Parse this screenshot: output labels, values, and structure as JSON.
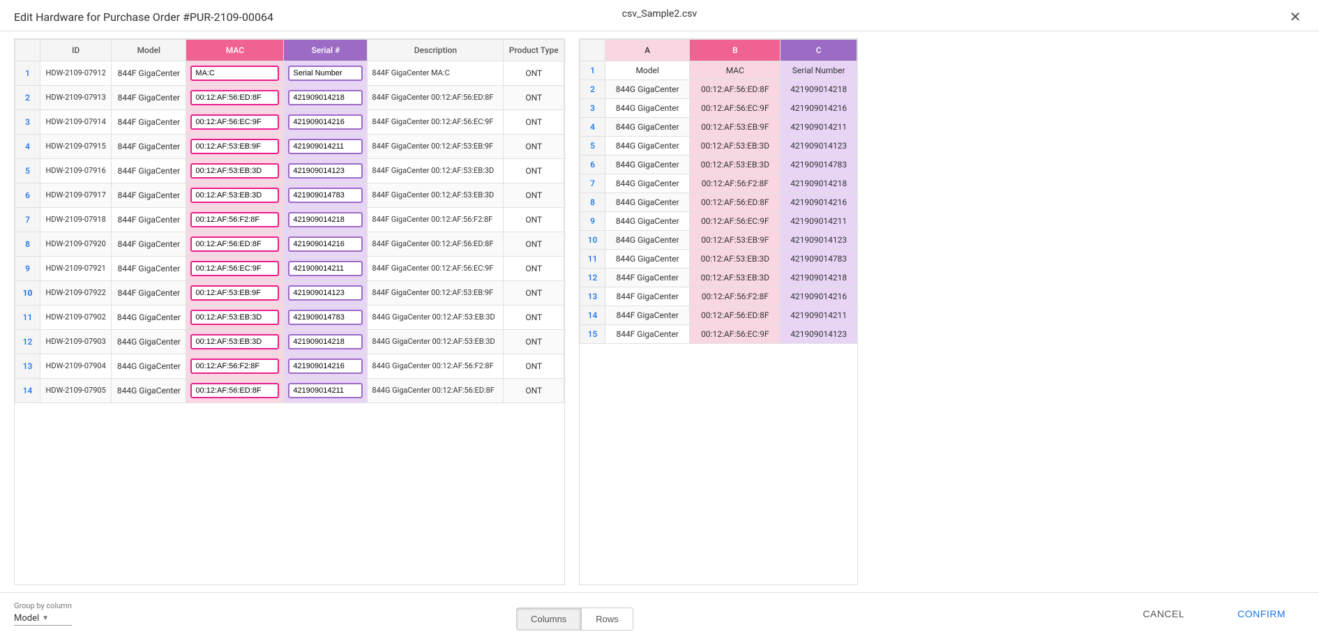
{
  "header": {
    "title": "Edit Hardware for Purchase Order #PUR-2109-00064",
    "csv_filename": "csv_Sample2.csv",
    "close_label": "×"
  },
  "left_table": {
    "columns": [
      "",
      "ID",
      "Model",
      "MAC",
      "Serial #",
      "Description",
      "Product Type"
    ],
    "rows": [
      {
        "num": 1,
        "id": "HDW-2109-07912",
        "model": "844F GigaCenter",
        "mac": "MA:C",
        "serial": "Serial Number",
        "desc": "844F GigaCenter MA:C",
        "type": "ONT"
      },
      {
        "num": 2,
        "id": "HDW-2109-07913",
        "model": "844F GigaCenter",
        "mac": "00:12:AF:56:ED:8F",
        "serial": "421909014218",
        "desc": "844F GigaCenter 00:12:AF:56:ED:8F",
        "type": "ONT"
      },
      {
        "num": 3,
        "id": "HDW-2109-07914",
        "model": "844F GigaCenter",
        "mac": "00:12:AF:56:EC:9F",
        "serial": "421909014216",
        "desc": "844F GigaCenter 00:12:AF:56:EC:9F",
        "type": "ONT"
      },
      {
        "num": 4,
        "id": "HDW-2109-07915",
        "model": "844F GigaCenter",
        "mac": "00:12:AF:53:EB:9F",
        "serial": "421909014211",
        "desc": "844F GigaCenter 00:12:AF:53:EB:9F",
        "type": "ONT"
      },
      {
        "num": 5,
        "id": "HDW-2109-07916",
        "model": "844F GigaCenter",
        "mac": "00:12:AF:53:EB:3D",
        "serial": "421909014123",
        "desc": "844F GigaCenter 00:12:AF:53:EB:3D",
        "type": "ONT"
      },
      {
        "num": 6,
        "id": "HDW-2109-07917",
        "model": "844F GigaCenter",
        "mac": "00:12:AF:53:EB:3D",
        "serial": "421909014783",
        "desc": "844F GigaCenter 00:12:AF:53:EB:3D",
        "type": "ONT"
      },
      {
        "num": 7,
        "id": "HDW-2109-07918",
        "model": "844F GigaCenter",
        "mac": "00:12:AF:56:F2:8F",
        "serial": "421909014218",
        "desc": "844F GigaCenter 00:12:AF:56:F2:8F",
        "type": "ONT"
      },
      {
        "num": 8,
        "id": "HDW-2109-07920",
        "model": "844F GigaCenter",
        "mac": "00:12:AF:56:ED:8F",
        "serial": "421909014216",
        "desc": "844F GigaCenter 00:12:AF:56:ED:8F",
        "type": "ONT"
      },
      {
        "num": 9,
        "id": "HDW-2109-07921",
        "model": "844F GigaCenter",
        "mac": "00:12:AF:56:EC:9F",
        "serial": "421909014211",
        "desc": "844F GigaCenter 00:12:AF:56:EC:9F",
        "type": "ONT"
      },
      {
        "num": 10,
        "id": "HDW-2109-07922",
        "model": "844F GigaCenter",
        "mac": "00:12:AF:53:EB:9F",
        "serial": "421909014123",
        "desc": "844F GigaCenter 00:12:AF:53:EB:9F",
        "type": "ONT"
      },
      {
        "num": 11,
        "id": "HDW-2109-07902",
        "model": "844G GigaCenter",
        "mac": "00:12:AF:53:EB:3D",
        "serial": "421909014783",
        "desc": "844G GigaCenter 00:12:AF:53:EB:3D",
        "type": "ONT"
      },
      {
        "num": 12,
        "id": "HDW-2109-07903",
        "model": "844G GigaCenter",
        "mac": "00:12:AF:53:EB:3D",
        "serial": "421909014218",
        "desc": "844G GigaCenter 00:12:AF:53:EB:3D",
        "type": "ONT"
      },
      {
        "num": 13,
        "id": "HDW-2109-07904",
        "model": "844G GigaCenter",
        "mac": "00:12:AF:56:F2:8F",
        "serial": "421909014216",
        "desc": "844G GigaCenter 00:12:AF:56:F2:8F",
        "type": "ONT"
      },
      {
        "num": 14,
        "id": "HDW-2109-07905",
        "model": "844G GigaCenter",
        "mac": "00:12:AF:56:ED:8F",
        "serial": "421909014211",
        "desc": "844G GigaCenter 00:12:AF:56:ED:8F",
        "type": "ONT"
      }
    ]
  },
  "right_table": {
    "col_headers": [
      "",
      "A",
      "B",
      "C"
    ],
    "rows": [
      {
        "num": 1,
        "a": "Model",
        "b": "MAC",
        "c": "Serial Number"
      },
      {
        "num": 2,
        "a": "844G GigaCenter",
        "b": "00:12:AF:56:ED:8F",
        "c": "421909014218"
      },
      {
        "num": 3,
        "a": "844G GigaCenter",
        "b": "00:12:AF:56:EC:9F",
        "c": "421909014216"
      },
      {
        "num": 4,
        "a": "844G GigaCenter",
        "b": "00:12:AF:53:EB:9F",
        "c": "421909014211"
      },
      {
        "num": 5,
        "a": "844G GigaCenter",
        "b": "00:12:AF:53:EB:3D",
        "c": "421909014123"
      },
      {
        "num": 6,
        "a": "844G GigaCenter",
        "b": "00:12:AF:53:EB:3D",
        "c": "421909014783"
      },
      {
        "num": 7,
        "a": "844G GigaCenter",
        "b": "00:12:AF:56:F2:8F",
        "c": "421909014218"
      },
      {
        "num": 8,
        "a": "844G GigaCenter",
        "b": "00:12:AF:56:ED:8F",
        "c": "421909014216"
      },
      {
        "num": 9,
        "a": "844G GigaCenter",
        "b": "00:12:AF:56:EC:9F",
        "c": "421909014211"
      },
      {
        "num": 10,
        "a": "844G GigaCenter",
        "b": "00:12:AF:53:EB:9F",
        "c": "421909014123"
      },
      {
        "num": 11,
        "a": "844G GigaCenter",
        "b": "00:12:AF:53:EB:3D",
        "c": "421909014783"
      },
      {
        "num": 12,
        "a": "844F GigaCenter",
        "b": "00:12:AF:53:EB:3D",
        "c": "421909014218"
      },
      {
        "num": 13,
        "a": "844F GigaCenter",
        "b": "00:12:AF:56:F2:8F",
        "c": "421909014216"
      },
      {
        "num": 14,
        "a": "844F GigaCenter",
        "b": "00:12:AF:56:ED:8F",
        "c": "421909014211"
      },
      {
        "num": 15,
        "a": "844F GigaCenter",
        "b": "00:12:AF:56:EC:9F",
        "c": "421909014123"
      }
    ]
  },
  "footer": {
    "group_by_label": "Group by column",
    "group_by_value": "Model",
    "columns_btn": "Columns",
    "rows_btn": "Rows",
    "cancel_btn": "CANCEL",
    "confirm_btn": "CONFIRM"
  }
}
